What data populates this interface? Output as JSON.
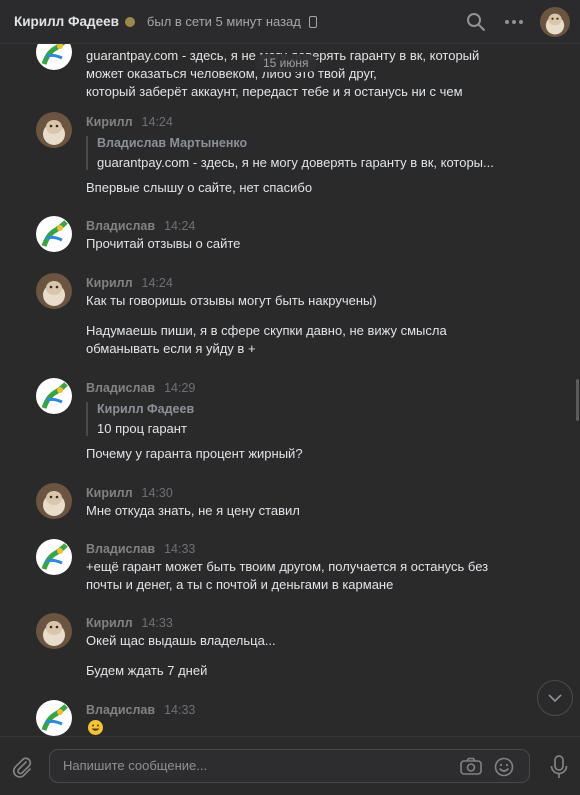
{
  "header": {
    "title": "Кирилл Фадеев",
    "status": "был в сети 5 минут назад"
  },
  "date_pill": "15 июня",
  "messages": [
    {
      "lines": [
        "guarantpay.com - здесь, я не могу доверять гаранту в вк, который",
        "может оказаться человеком, либо это твой друг,",
        "который заберёт аккаунт, передаст тебе и я останусь ни с чем"
      ]
    },
    {
      "name": "Кирилл",
      "time": "14:24",
      "quote": {
        "name": "Владислав Мартыненко",
        "text": "guarantpay.com - здесь, я не могу доверять гаранту в вк, которы..."
      },
      "lines": [
        "Впервые слышу о сайте, нет спасибо"
      ]
    },
    {
      "name": "Владислав",
      "time": "14:24",
      "lines": [
        "Прочитай отзывы о сайте"
      ]
    },
    {
      "name": "Кирилл",
      "time": "14:24",
      "lines": [
        "Как ты говоришь отзывы могут быть накручены)",
        "Надумаешь пиши, я в сфере скупки давно, не вижу смысла",
        "обманывать если я уйду в +"
      ]
    },
    {
      "name": "Владислав",
      "time": "14:29",
      "quote": {
        "name": "Кирилл Фадеев",
        "text": "10 проц гарант"
      },
      "lines": [
        "Почему у гаранта процент жирный?"
      ]
    },
    {
      "name": "Кирилл",
      "time": "14:30",
      "lines": [
        "Мне откуда знать, не я цену ставил"
      ]
    },
    {
      "name": "Владислав",
      "time": "14:33",
      "lines": [
        "+ещё гарант может быть твоим другом, получается я останусь без",
        "почты и денег, а ты с почтой и деньгами в кармане"
      ]
    },
    {
      "name": "Кирилл",
      "time": "14:33",
      "lines": [
        "Окей щас выдашь владельца...",
        "Будем ждать 7 дней"
      ]
    },
    {
      "name": "Владислав",
      "time": "14:33",
      "emoji": "grinning-face"
    }
  ],
  "composer": {
    "placeholder": "Напишите сообщение..."
  },
  "colors": {
    "background": "#2a2a2b",
    "name": "#828282",
    "text": "#e1e3e6",
    "icon": "#828282"
  }
}
